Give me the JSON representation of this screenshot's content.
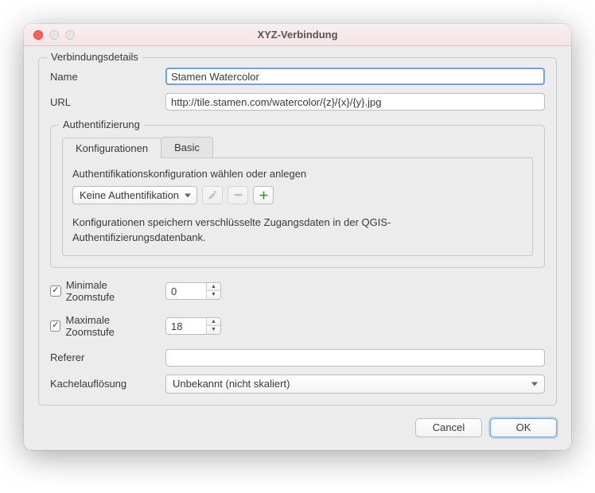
{
  "window": {
    "title": "XYZ-Verbindung"
  },
  "details": {
    "group_label": "Verbindungsdetails",
    "name_label": "Name",
    "name_value": "Stamen Watercolor",
    "url_label": "URL",
    "url_value": "http://tile.stamen.com/watercolor/{z}/{x}/{y}.jpg"
  },
  "auth": {
    "group_label": "Authentifizierung",
    "tabs": {
      "config": "Konfigurationen",
      "basic": "Basic"
    },
    "choose_label": "Authentifikationskonfiguration wählen oder anlegen",
    "dropdown_value": "Keine Authentifikation",
    "hint": "Konfigurationen speichern verschlüsselte Zugangsdaten in der QGIS-Authentifizierungsdatenbank.",
    "icons": {
      "edit": "edit-icon",
      "remove": "remove-icon",
      "add": "add-icon"
    }
  },
  "zoom": {
    "min_checked": true,
    "min_label": "Minimale Zoomstufe",
    "min_value": "0",
    "max_checked": true,
    "max_label": "Maximale Zoomstufe",
    "max_value": "18"
  },
  "referer": {
    "label": "Referer",
    "value": ""
  },
  "resolution": {
    "label": "Kachelauflösung",
    "value": "Unbekannt (nicht skaliert)"
  },
  "buttons": {
    "cancel": "Cancel",
    "ok": "OK"
  }
}
